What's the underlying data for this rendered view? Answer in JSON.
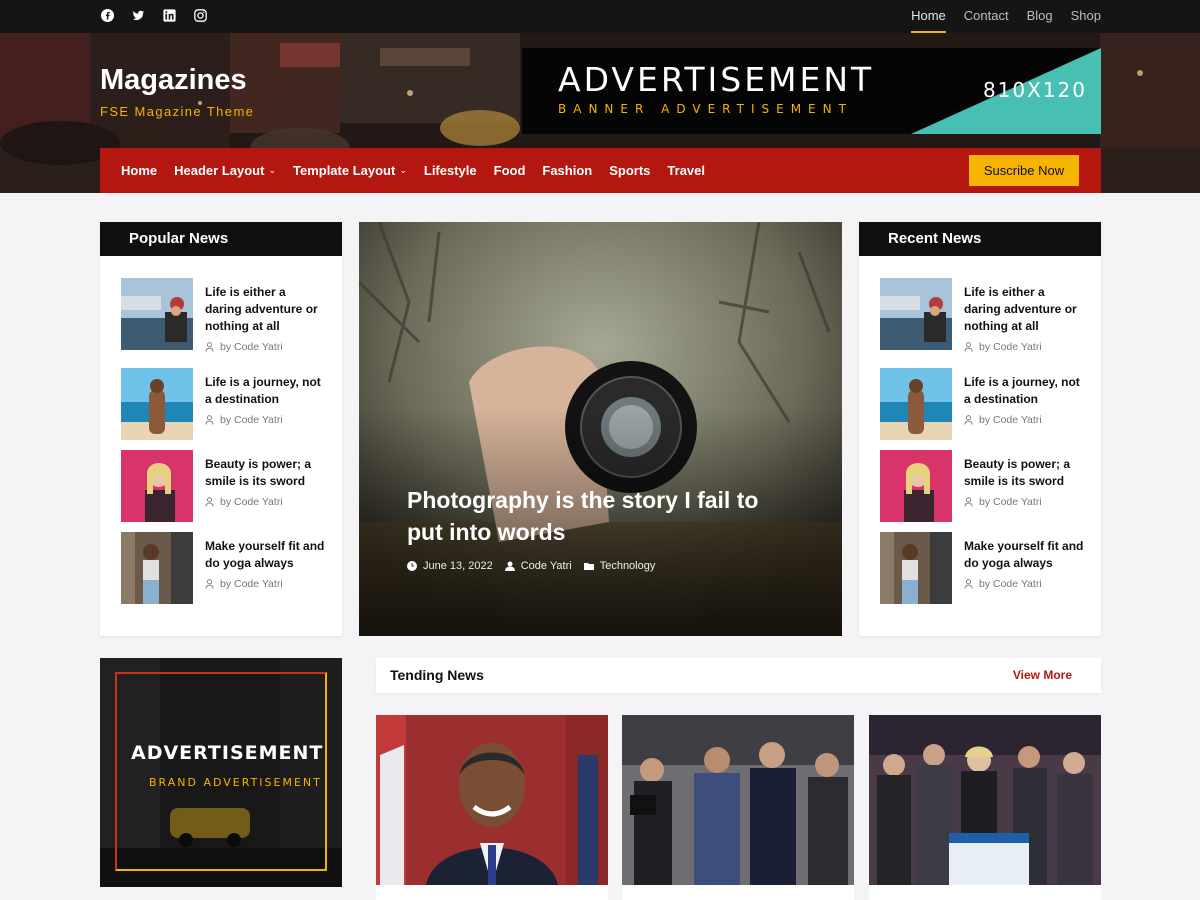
{
  "topbar": {
    "social_icons": [
      "facebook-icon",
      "twitter-icon",
      "linkedin-icon",
      "instagram-icon"
    ],
    "nav": [
      {
        "label": "Home",
        "active": true
      },
      {
        "label": "Contact",
        "active": false
      },
      {
        "label": "Blog",
        "active": false
      },
      {
        "label": "Shop",
        "active": false
      }
    ]
  },
  "header": {
    "site_title": "Magazines",
    "tagline": "FSE Magazine Theme",
    "banner": {
      "title": "ADVERTISEMENT",
      "subtitle": "BANNER ADVERTISEMENT",
      "size": "810X120"
    }
  },
  "main_nav": {
    "items": [
      {
        "label": "Home",
        "dropdown": false
      },
      {
        "label": "Header Layout",
        "dropdown": true
      },
      {
        "label": "Template Layout",
        "dropdown": true
      },
      {
        "label": "Lifestyle",
        "dropdown": false
      },
      {
        "label": "Food",
        "dropdown": false
      },
      {
        "label": "Fashion",
        "dropdown": false
      },
      {
        "label": "Sports",
        "dropdown": false
      },
      {
        "label": "Travel",
        "dropdown": false
      }
    ],
    "chevron": "⌄",
    "subscribe_label": "Suscribe Now"
  },
  "popular_news": {
    "heading": "Popular News",
    "items": [
      {
        "title": "Life is either a daring adventure or nothing at all",
        "author": "by Code Yatri"
      },
      {
        "title": "Life is a journey, not a destination",
        "author": "by Code Yatri"
      },
      {
        "title": "Beauty is power; a smile is its sword",
        "author": "by Code Yatri"
      },
      {
        "title": "Make yourself fit and do yoga always",
        "author": "by Code Yatri"
      }
    ]
  },
  "recent_news": {
    "heading": "Recent News",
    "items": [
      {
        "title": "Life is either a daring adventure or nothing at all",
        "author": "by Code Yatri"
      },
      {
        "title": "Life is a journey, not a destination",
        "author": "by Code Yatri"
      },
      {
        "title": "Beauty is power; a smile is its sword",
        "author": "by Code Yatri"
      },
      {
        "title": "Make yourself fit and do yoga always",
        "author": "by Code Yatri"
      }
    ]
  },
  "featured": {
    "title": "Photography is the story I fail to put into words",
    "date": "June 13, 2022",
    "author": "Code Yatri",
    "category": "Technology"
  },
  "side_ad": {
    "title": "ADVERTISEMENT",
    "subtitle": "BRAND ADVERTISEMENT"
  },
  "trending": {
    "heading": "Tending News",
    "view_more": "View More"
  },
  "colors": {
    "accent_red": "#b3170f",
    "accent_yellow": "#f5b400",
    "teal": "#47bfb3",
    "dark": "#151515"
  }
}
